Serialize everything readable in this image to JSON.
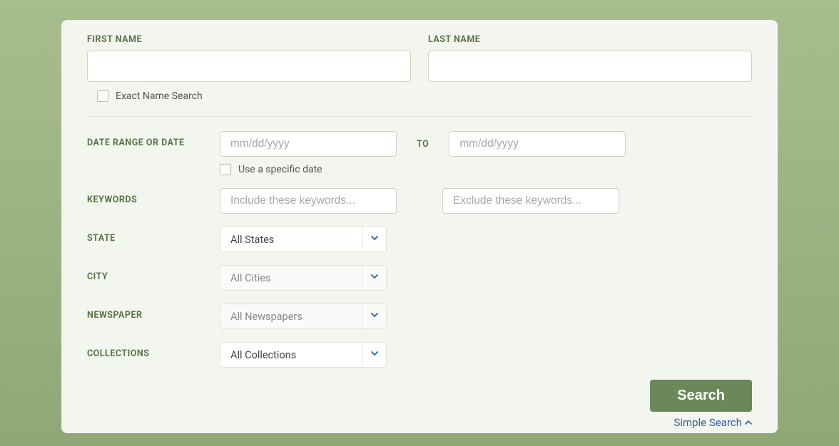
{
  "labels": {
    "firstName": "FIRST NAME",
    "lastName": "LAST NAME",
    "exactName": "Exact Name Search",
    "dateRange": "DATE RANGE OR DATE",
    "to": "TO",
    "specificDate": "Use a specific date",
    "keywords": "KEYWORDS",
    "state": "STATE",
    "city": "CITY",
    "newspaper": "NEWSPAPER",
    "collections": "COLLECTIONS"
  },
  "placeholders": {
    "dateFrom": "mm/dd/yyyy",
    "dateTo": "mm/dd/yyyy",
    "kwInclude": "Include these keywords...",
    "kwExclude": "Exclude these keywords..."
  },
  "selects": {
    "state": "All States",
    "city": "All Cities",
    "newspaper": "All Newspapers",
    "collections": "All Collections"
  },
  "buttons": {
    "search": "Search",
    "simpleSearch": "Simple Search"
  }
}
